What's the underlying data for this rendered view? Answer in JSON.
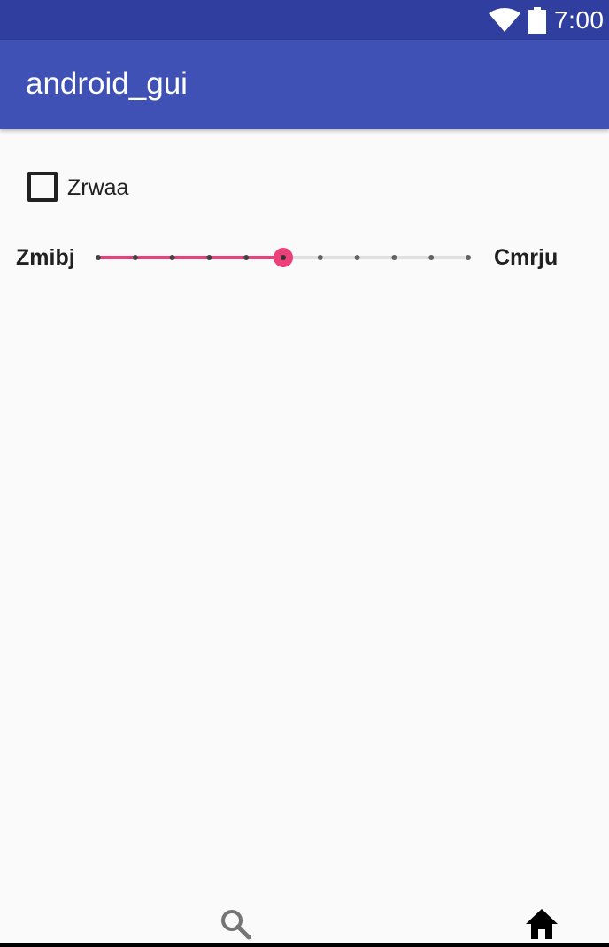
{
  "status_bar": {
    "time": "7:00",
    "icons": [
      "wifi-icon",
      "battery-icon"
    ]
  },
  "app_bar": {
    "title": "android_gui"
  },
  "checkbox": {
    "label": "Zrwaa",
    "checked": false
  },
  "seekbar": {
    "min_label": "Zmibj",
    "max_label": "Cmrju",
    "steps": 10,
    "progress": 5,
    "accent_color": "#ec407a"
  },
  "bottom_nav": {
    "icons": [
      "search-icon",
      "home-icon"
    ]
  },
  "colors": {
    "status_bar": "#303f9f",
    "app_bar": "#3f51b5",
    "background": "#fafafa"
  }
}
